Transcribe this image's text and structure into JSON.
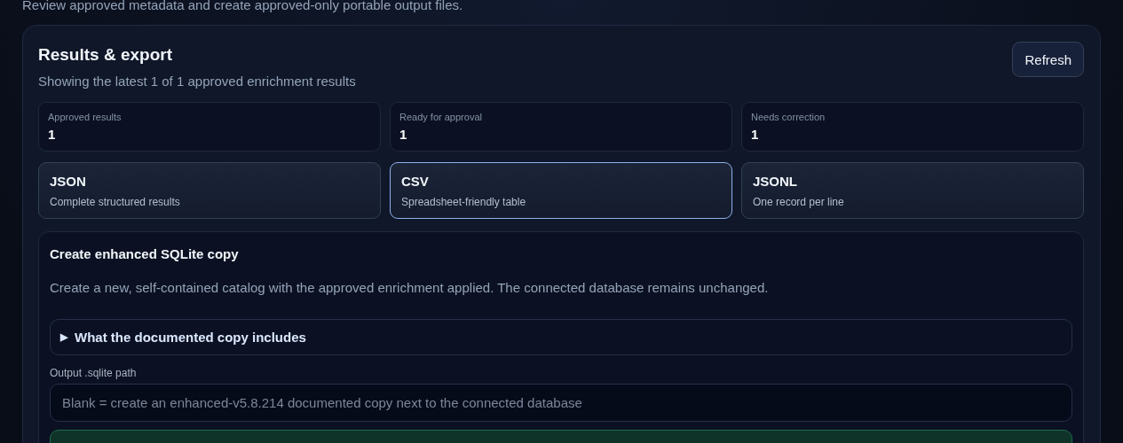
{
  "page_subtitle": "Review approved metadata and create approved-only portable output files.",
  "panel": {
    "title": "Results & export",
    "subtitle": "Showing the latest 1 of 1 approved enrichment results",
    "refresh_button": "Refresh",
    "stats": [
      {
        "label": "Approved results",
        "value": "1"
      },
      {
        "label": "Ready for approval",
        "value": "1"
      },
      {
        "label": "Needs correction",
        "value": "1"
      }
    ],
    "formats": [
      {
        "name": "JSON",
        "description": "Complete structured results",
        "selected": false
      },
      {
        "name": "CSV",
        "description": "Spreadsheet-friendly table",
        "selected": true
      },
      {
        "name": "JSONL",
        "description": "One record per line",
        "selected": false
      }
    ],
    "sqlite": {
      "title": "Create enhanced SQLite copy",
      "description": "Create a new, self-contained catalog with the approved enrichment applied. The connected database remains unchanged.",
      "details": {
        "marker": "▶",
        "summary": "What the documented copy includes",
        "expanded": false
      },
      "path_label": "Output .sqlite path",
      "path_placeholder": "Blank = create an enhanced-v5.8.214 documented copy next to the connected database"
    }
  }
}
